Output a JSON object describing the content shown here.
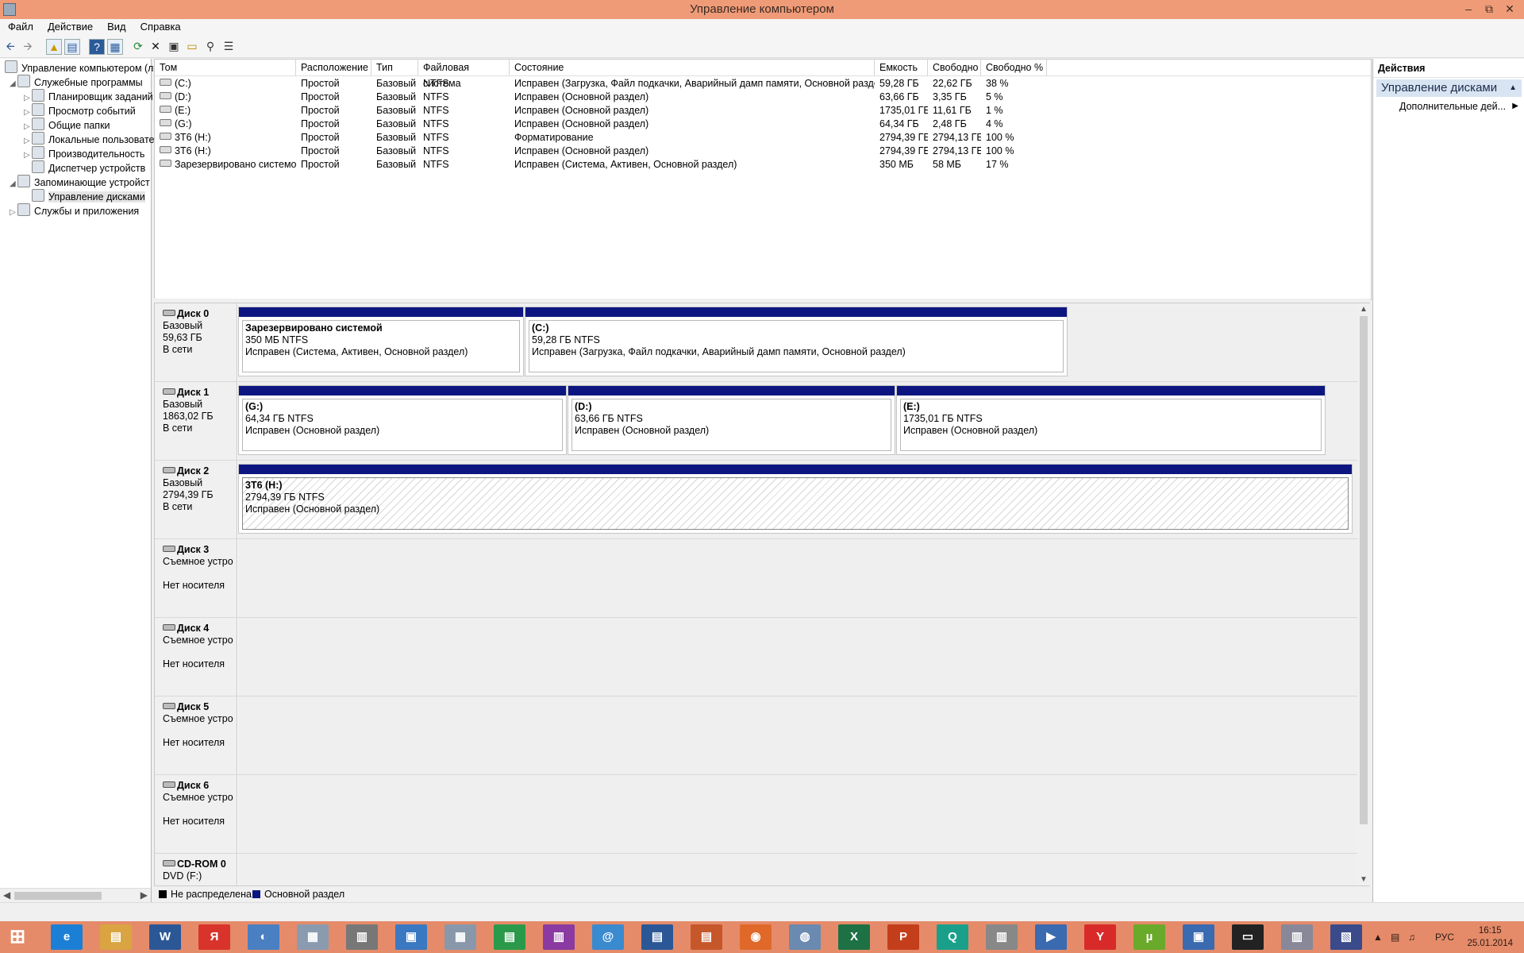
{
  "window": {
    "title": "Управление компьютером"
  },
  "menu": [
    "Файл",
    "Действие",
    "Вид",
    "Справка"
  ],
  "toolbar": {
    "icons": [
      "back-arrow-icon",
      "forward-arrow-icon",
      "folder-up-icon",
      "show-tree-icon",
      "help-icon",
      "console-icon",
      "refresh-icon",
      "delete-icon",
      "properties-icon",
      "open-icon",
      "search-icon",
      "list-icon"
    ]
  },
  "tree": {
    "root": "Управление компьютером (л",
    "system_tools": "Служебные программы",
    "scheduler": "Планировщик заданий",
    "event_viewer": "Просмотр событий",
    "shared_folders": "Общие папки",
    "local_users": "Локальные пользовате",
    "performance": "Производительность",
    "device_manager": "Диспетчер устройств",
    "storage": "Запоминающие устройст",
    "disk_management": "Управление дисками",
    "services": "Службы и приложения"
  },
  "volumes": {
    "columns": {
      "volume": "Том",
      "layout": "Расположение",
      "type": "Тип",
      "fs": "Файловая система",
      "status": "Состояние",
      "capacity": "Емкость",
      "free": "Свободно",
      "free_pct": "Свободно %"
    },
    "rows": [
      {
        "volume": "(C:)",
        "layout": "Простой",
        "type": "Базовый",
        "fs": "NTFS",
        "status": "Исправен (Загрузка, Файл подкачки, Аварийный дамп памяти, Основной раздел)",
        "capacity": "59,28 ГБ",
        "free": "22,62 ГБ",
        "free_pct": "38 %"
      },
      {
        "volume": "(D:)",
        "layout": "Простой",
        "type": "Базовый",
        "fs": "NTFS",
        "status": "Исправен (Основной раздел)",
        "capacity": "63,66 ГБ",
        "free": "3,35 ГБ",
        "free_pct": "5 %"
      },
      {
        "volume": "(E:)",
        "layout": "Простой",
        "type": "Базовый",
        "fs": "NTFS",
        "status": "Исправен (Основной раздел)",
        "capacity": "1735,01 ГБ",
        "free": "11,61 ГБ",
        "free_pct": "1 %"
      },
      {
        "volume": "(G:)",
        "layout": "Простой",
        "type": "Базовый",
        "fs": "NTFS",
        "status": "Исправен (Основной раздел)",
        "capacity": "64,34 ГБ",
        "free": "2,48 ГБ",
        "free_pct": "4 %"
      },
      {
        "volume": "3Т6 (H:)",
        "layout": "Простой",
        "type": "Базовый",
        "fs": "NTFS",
        "status": "Форматирование",
        "capacity": "2794,39 ГБ",
        "free": "2794,13 ГБ",
        "free_pct": "100 %"
      },
      {
        "volume": "3Т6 (H:)",
        "layout": "Простой",
        "type": "Базовый",
        "fs": "NTFS",
        "status": "Исправен (Основной раздел)",
        "capacity": "2794,39 ГБ",
        "free": "2794,13 ГБ",
        "free_pct": "100 %"
      },
      {
        "volume": "Зарезервировано системой",
        "layout": "Простой",
        "type": "Базовый",
        "fs": "NTFS",
        "status": "Исправен (Система, Активен, Основной раздел)",
        "capacity": "350 МБ",
        "free": "58 МБ",
        "free_pct": "17 %"
      }
    ]
  },
  "disks": [
    {
      "name": "Диск 0",
      "type": "Базовый",
      "size": "59,63 ГБ",
      "state": "В сети",
      "partitions": [
        {
          "name": "Зарезервировано системой",
          "fs": "350 МБ NTFS",
          "status": "Исправен (Система, Активен, Основной раздел)"
        },
        {
          "name": "(C:)",
          "fs": "59,28 ГБ NTFS",
          "status": "Исправен (Загрузка, Файл подкачки, Аварийный дамп памяти, Основной раздел)"
        }
      ]
    },
    {
      "name": "Диск 1",
      "type": "Базовый",
      "size": "1863,02 ГБ",
      "state": "В сети",
      "partitions": [
        {
          "name": "(G:)",
          "fs": "64,34 ГБ NTFS",
          "status": "Исправен (Основной раздел)"
        },
        {
          "name": "(D:)",
          "fs": "63,66 ГБ NTFS",
          "status": "Исправен (Основной раздел)"
        },
        {
          "name": "(E:)",
          "fs": "1735,01 ГБ NTFS",
          "status": "Исправен (Основной раздел)"
        }
      ]
    },
    {
      "name": "Диск 2",
      "type": "Базовый",
      "size": "2794,39 ГБ",
      "state": "В сети",
      "partitions": [
        {
          "name": "3Т6  (H:)",
          "fs": "2794,39 ГБ NTFS",
          "status": "Исправен (Основной раздел)"
        }
      ]
    },
    {
      "name": "Диск 3",
      "type": "Съемное устро",
      "size": "",
      "state": "Нет носителя",
      "partitions": []
    },
    {
      "name": "Диск 4",
      "type": "Съемное устро",
      "size": "",
      "state": "Нет носителя",
      "partitions": []
    },
    {
      "name": "Диск 5",
      "type": "Съемное устро",
      "size": "",
      "state": "Нет носителя",
      "partitions": []
    },
    {
      "name": "Диск 6",
      "type": "Съемное устро",
      "size": "",
      "state": "Нет носителя",
      "partitions": []
    },
    {
      "name": "CD-ROM 0",
      "type": "DVD (F:)",
      "size": "",
      "state": "",
      "partitions": []
    }
  ],
  "legend": {
    "unallocated": "Не распределена",
    "unallocated_color": "#000000",
    "primary": "Основной раздел",
    "primary_color": "#0d1680"
  },
  "actions": {
    "header": "Действия",
    "section": "Управление дисками",
    "more": "Дополнительные дей..."
  },
  "taskbar": {
    "apps": [
      "windows-start-icon",
      "internet-explorer-icon",
      "file-explorer-icon",
      "word-icon",
      "yandex-icon",
      "media-icon",
      "photo-icon",
      "archive-icon",
      "control-panel-icon",
      "calculator-icon",
      "spreadsheet-icon",
      "database-icon",
      "mail-icon",
      "writer-icon",
      "presentation-icon",
      "firefox-icon",
      "paint-icon",
      "excel-icon",
      "powerpoint-icon",
      "q-app-icon",
      "printer-icon",
      "player-icon",
      "yandex-browser-icon",
      "utorrent-icon",
      "computer-management-icon",
      "cmd-icon",
      "tool-icon",
      "remote-icon"
    ],
    "lang": "РУС",
    "time": "16:15",
    "date": "25.01.2014"
  }
}
